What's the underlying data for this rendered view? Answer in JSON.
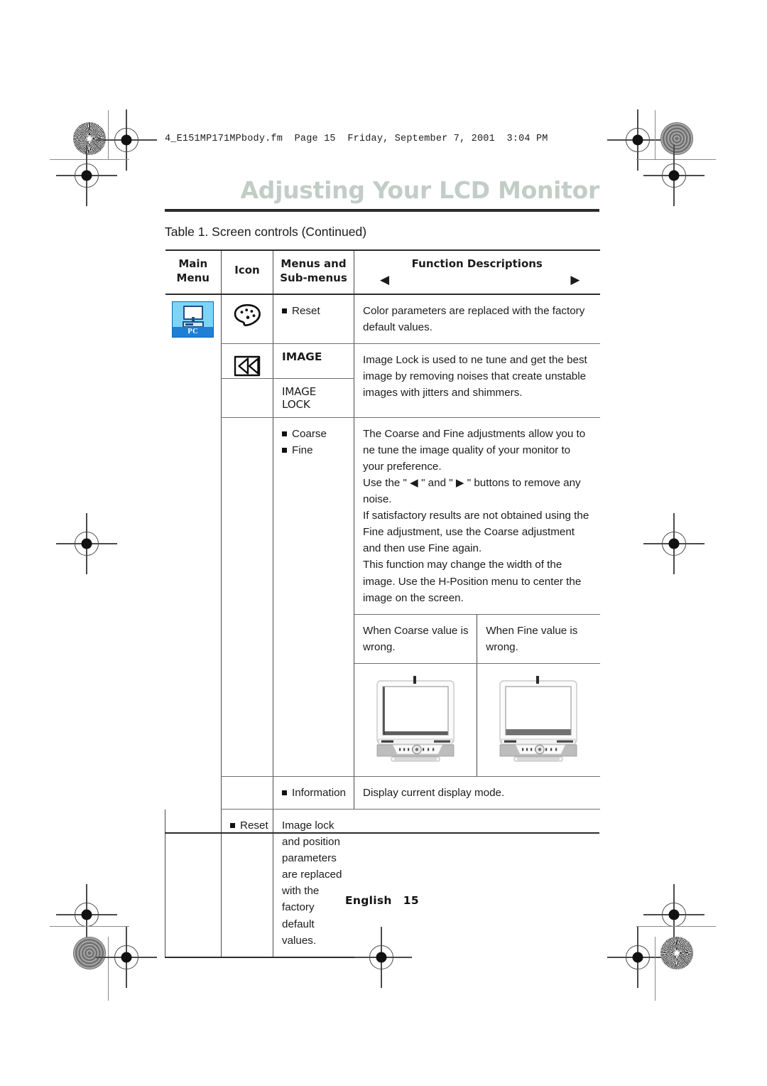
{
  "header": {
    "file_strip": "4_E151MP171MPbody.fm  Page 15  Friday, September 7, 2001  3:04 PM",
    "title": "Adjusting Your LCD Monitor"
  },
  "table": {
    "caption": "Table 1.  Screen controls (Continued)",
    "columns": {
      "main_menu": "Main\nMenu",
      "main_menu_line1": "Main",
      "main_menu_line2": "Menu",
      "icon": "Icon",
      "menus_line1": "Menus and",
      "menus_line2": "Sub-menus",
      "function_descriptions": "Function Descriptions",
      "arrow_left": "◀",
      "arrow_right": "▶"
    },
    "rows": [
      {
        "main_menu_icon": "pc-monitor-icon",
        "main_menu_icon_label": "PC",
        "icon": "palette-icon",
        "menus": [
          {
            "label": "Reset",
            "bulleted": true
          }
        ],
        "description": "Color parameters are replaced with the factory default values."
      },
      {
        "icon": "image-lock-icon",
        "menus_primary": "IMAGE",
        "menus_secondary": "IMAGE LOCK",
        "description": "Image Lock is used to  ne tune and get the best image by removing noises that create unstable images with jitters and shimmers."
      },
      {
        "menus": [
          {
            "label": "Coarse",
            "bulleted": true
          },
          {
            "label": "Fine",
            "bulleted": true
          }
        ],
        "description_paragraphs": [
          "The Coarse and Fine adjustments allow you to  ne tune the image quality of your monitor to your preference.",
          "Use the \" ◀ \" and \" ▶ \" buttons to remove any noise.",
          "If satisfactory results are not obtained using the Fine adjustment, use the Coarse adjustment and then use Fine again.",
          "This function may change the width of the image. Use the H-Position menu to center the image on the screen."
        ],
        "examples": [
          {
            "caption": "When Coarse value is wrong.",
            "image": "monitor-illustration"
          },
          {
            "caption": "When Fine value is wrong.",
            "image": "monitor-illustration"
          }
        ]
      },
      {
        "menus": [
          {
            "label": "Information",
            "bulleted": true
          }
        ],
        "description": "Display current display mode."
      },
      {
        "menus": [
          {
            "label": "Reset",
            "bulleted": true
          }
        ],
        "description": "Image lock and position parameters are replaced with the factory default values."
      }
    ]
  },
  "footer": {
    "language": "English",
    "page_number": "15"
  },
  "colors": {
    "title": "#c2cdc7",
    "pc_icon_bg": "#7fd4f5",
    "pc_icon_label_bg": "#1f7fd4",
    "rule": "#2b2b2b"
  }
}
